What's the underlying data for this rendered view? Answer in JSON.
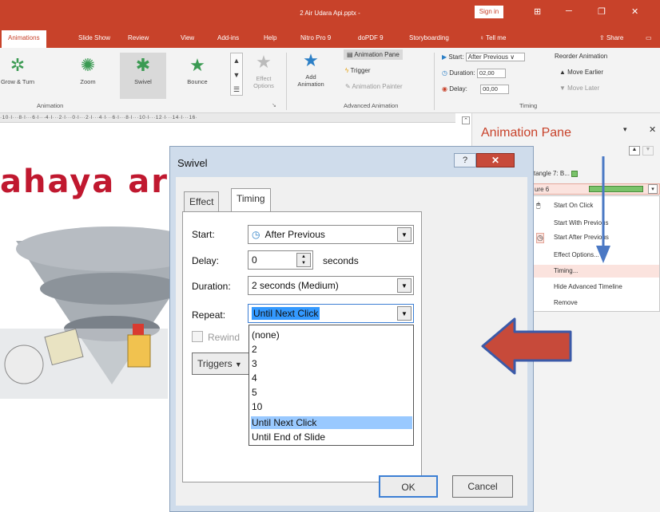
{
  "window": {
    "title": "2 Air Udara Api.pptx -",
    "sign_in": "Sign in",
    "share": "Share"
  },
  "tabs": [
    "Animations",
    "Slide Show",
    "Review",
    "View",
    "Add-ins",
    "Help",
    "Nitro Pro 9",
    "doPDF 9",
    "Storyboarding",
    "Tell me"
  ],
  "ribbon": {
    "animations": [
      "Grow & Turn",
      "Zoom",
      "Swivel",
      "Bounce"
    ],
    "effect_options": "Effect Options",
    "add_animation": "Add Animation",
    "animation_pane": "Animation Pane",
    "trigger": "Trigger",
    "animation_painter": "Animation Painter",
    "start_label": "Start:",
    "start_value": "After Previous",
    "duration_label": "Duration:",
    "duration_value": "02,00",
    "delay_label": "Delay:",
    "delay_value": "00,00",
    "reorder": "Reorder Animation",
    "move_earlier": "Move Earlier",
    "move_later": "Move Later",
    "group_animation": "Animation",
    "group_advanced": "Advanced Animation",
    "group_timing": "Timing"
  },
  "ruler": "·10·l···8·l···6·l···4·l···2·l···0·l···2·l···4·l···6·l···8·l···10·l···12·l···14·l···16·",
  "slide": {
    "title": "ahaya ar"
  },
  "pane": {
    "title": "Animation Pane",
    "item1": "tangle 7: B...",
    "item2": "ure 6",
    "menu": [
      "Start On Click",
      "Start With Previous",
      "Start After Previous",
      "Effect Options...",
      "Timing...",
      "Hide Advanced Timeline",
      "Remove"
    ]
  },
  "dialog": {
    "title": "Swivel",
    "tab_effect": "Effect",
    "tab_timing": "Timing",
    "start_label": "Start:",
    "start_value": "After Previous",
    "delay_label": "Delay:",
    "delay_value": "0",
    "delay_unit": "seconds",
    "duration_label": "Duration:",
    "duration_value": "2 seconds (Medium)",
    "repeat_label": "Repeat:",
    "repeat_value": "Until Next Click",
    "rewind_label": "Rewind",
    "triggers_label": "Triggers",
    "repeat_options": [
      "(none)",
      "2",
      "3",
      "4",
      "5",
      "10",
      "Until Next Click",
      "Until End of Slide"
    ],
    "ok": "OK",
    "cancel": "Cancel"
  },
  "colors": {
    "accent": "#c8422a",
    "slide_title": "#c0182f",
    "arrow": "#c74a3a"
  }
}
